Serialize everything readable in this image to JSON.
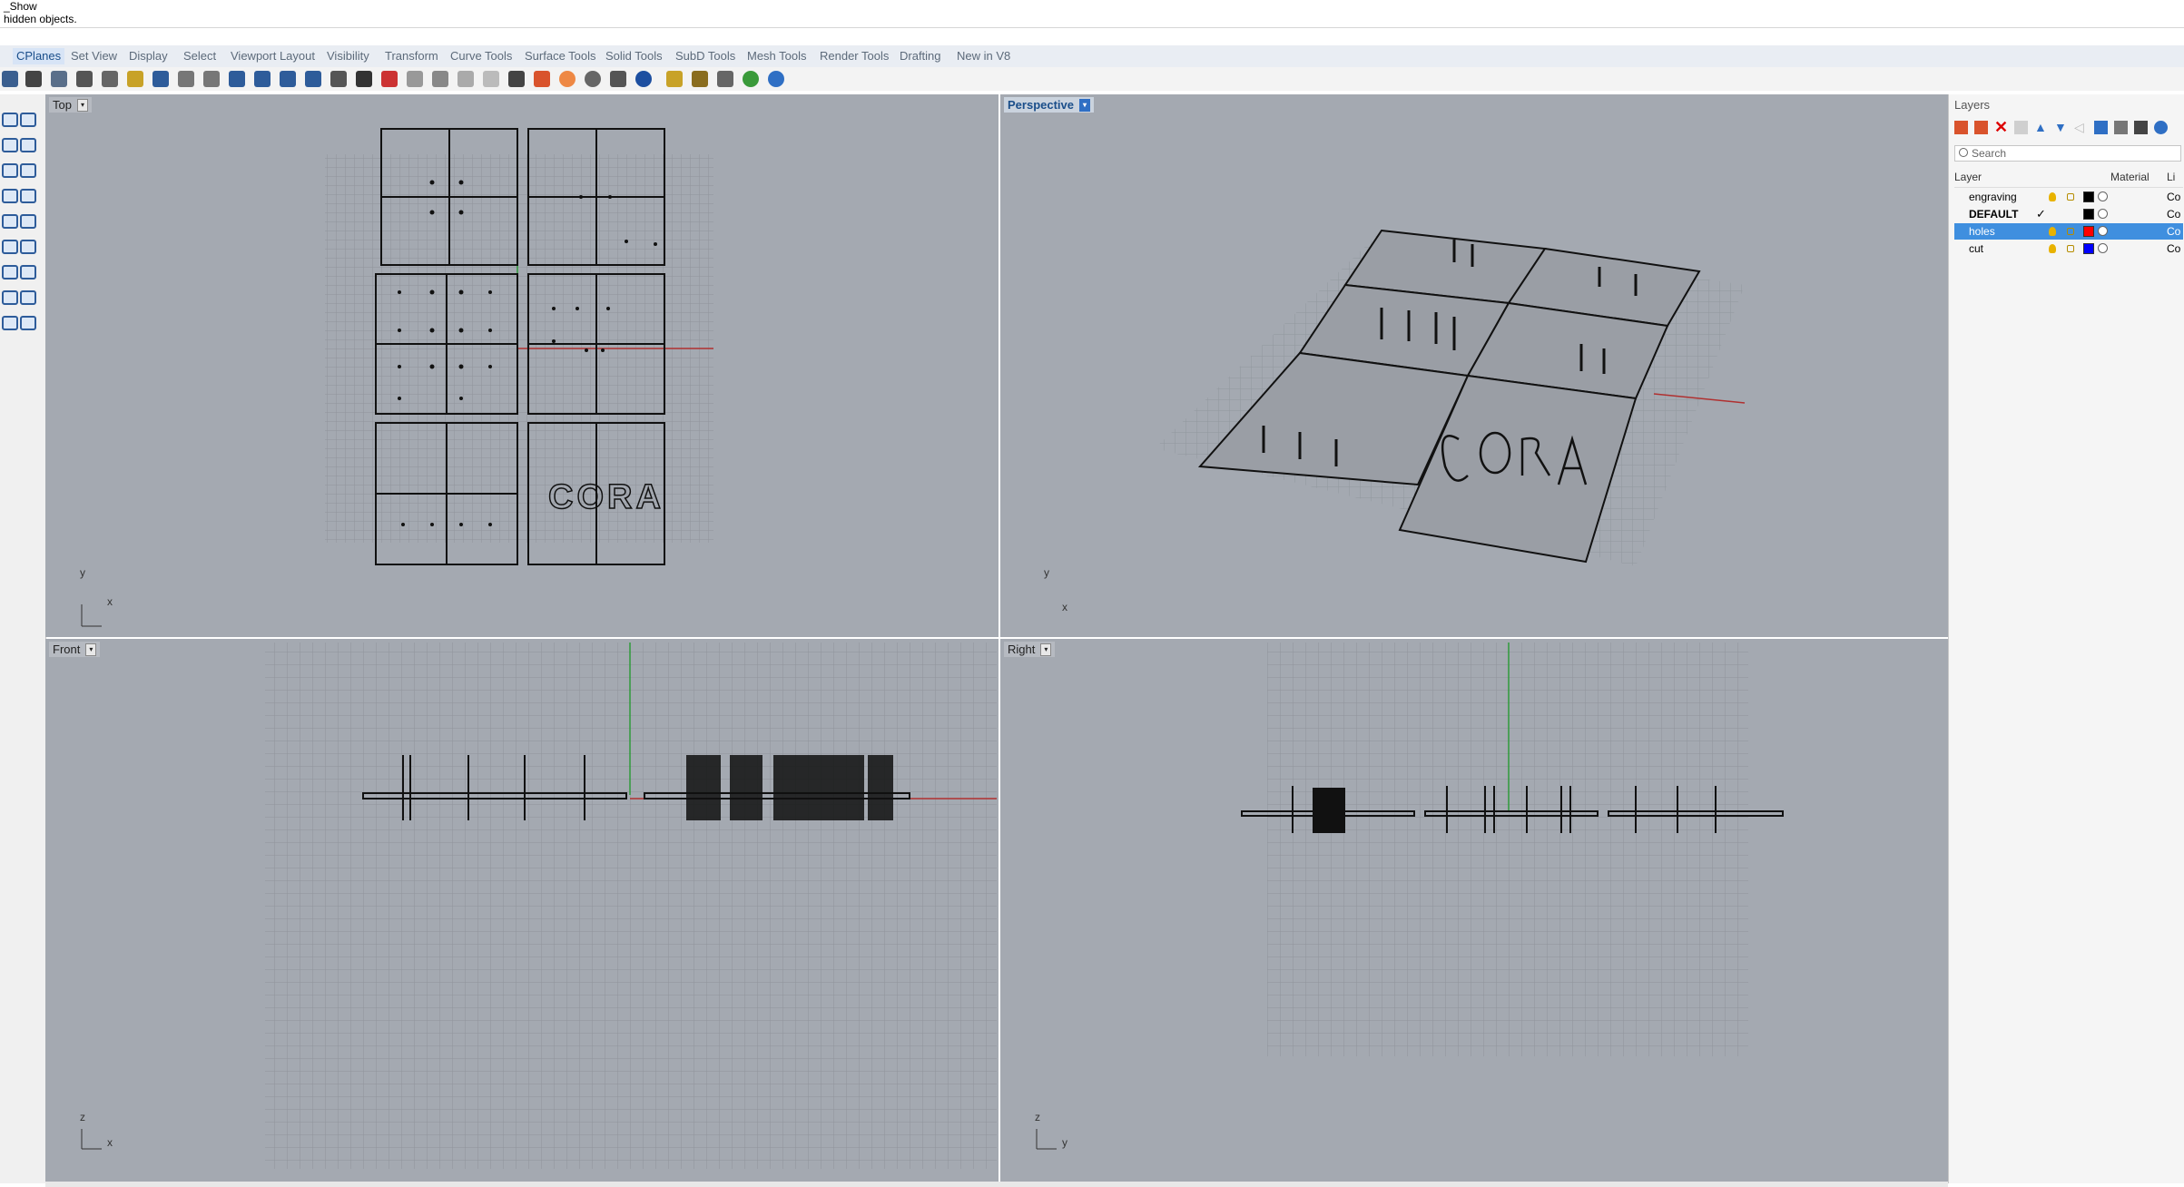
{
  "command": {
    "history": [
      "_Show",
      "hidden objects."
    ]
  },
  "menu_tabs": [
    {
      "label": "CPlanes",
      "active": true
    },
    {
      "label": "Set View"
    },
    {
      "label": "Display"
    },
    {
      "label": "Select"
    },
    {
      "label": "Viewport Layout"
    },
    {
      "label": "Visibility"
    },
    {
      "label": "Transform"
    },
    {
      "label": "Curve Tools"
    },
    {
      "label": "Surface Tools"
    },
    {
      "label": "Solid Tools"
    },
    {
      "label": "SubD Tools"
    },
    {
      "label": "Mesh Tools"
    },
    {
      "label": "Render Tools"
    },
    {
      "label": "Drafting"
    },
    {
      "label": "New in V8"
    }
  ],
  "viewports": {
    "top": {
      "label": "Top",
      "axis_x": "x",
      "axis_y": "y",
      "engraving_text": "CORA"
    },
    "perspective": {
      "label": "Perspective",
      "axis_x": "x",
      "axis_y": "y",
      "active": true
    },
    "front": {
      "label": "Front",
      "axis_x": "x",
      "axis_y": "z"
    },
    "right": {
      "label": "Right",
      "axis_x": "y",
      "axis_y": "z"
    }
  },
  "layers": {
    "title": "Layers",
    "search_placeholder": "Search",
    "columns": [
      "Layer",
      "Material",
      "Li"
    ],
    "rows": [
      {
        "name": "engraving",
        "color": "#000000",
        "line": "Co",
        "current": false,
        "selected": false
      },
      {
        "name": "DEFAULT",
        "color": "#000000",
        "line": "Co",
        "current": true,
        "selected": false
      },
      {
        "name": "holes",
        "color": "#ff0000",
        "line": "Co",
        "current": false,
        "selected": true
      },
      {
        "name": "cut",
        "color": "#0000ff",
        "line": "Co",
        "current": false,
        "selected": false
      }
    ]
  },
  "colors": {
    "viewport_bg": "#a4a9b1",
    "grid": "#8f949b",
    "x_axis": "#b03030",
    "y_axis": "#2f9a3a",
    "selected_row": "#3f8fdf"
  }
}
